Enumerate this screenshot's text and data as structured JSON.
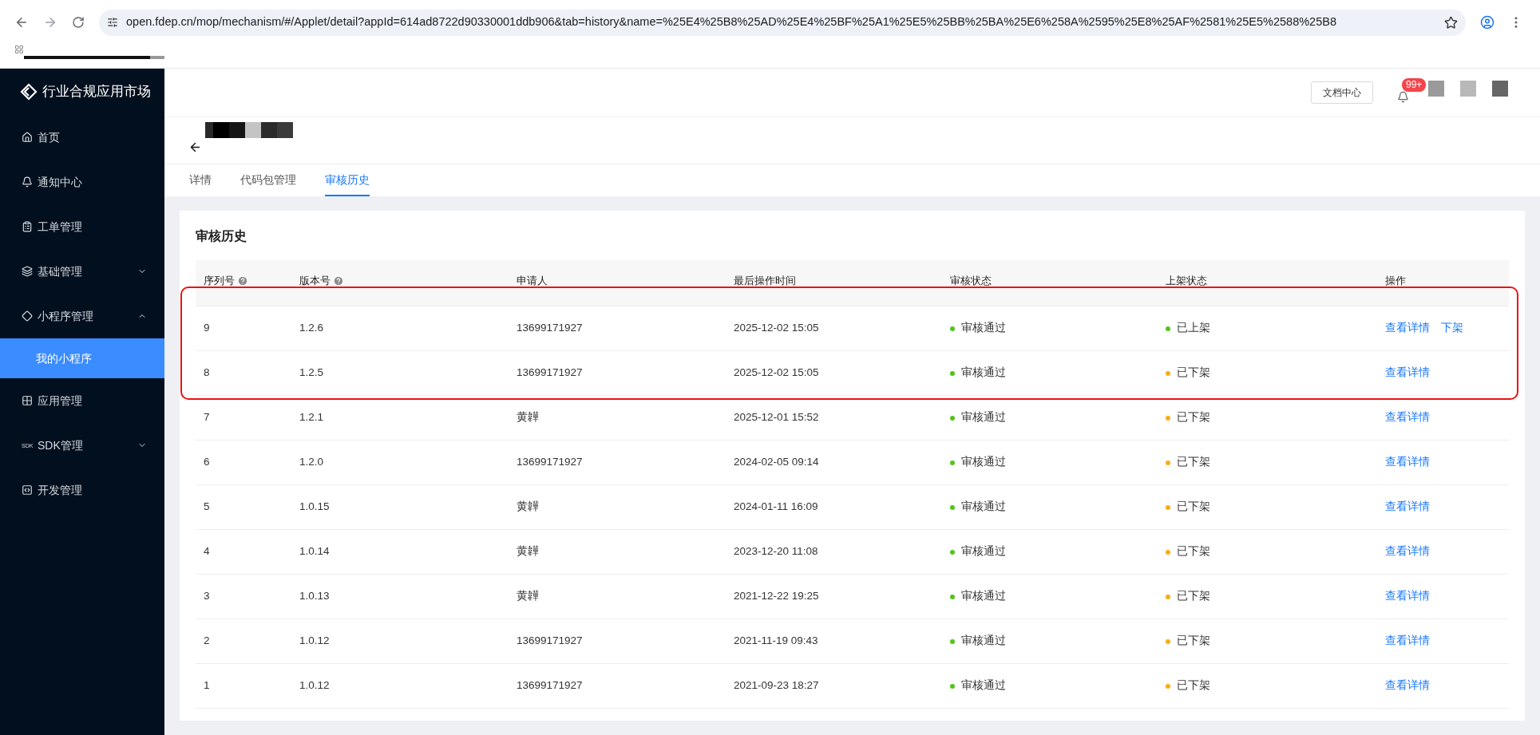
{
  "browser": {
    "url": "open.fdep.cn/mop/mechanism/#/Applet/detail?appId=614ad8722d90330001ddb906&tab=history&name=%25E4%25B8%25AD%25E4%25BF%25A1%25E5%25BB%25BA%25E6%258A%2595%25E8%25AF%2581%25E5%2588%25B8"
  },
  "sidebar": {
    "logo": "行业合规应用市场",
    "items": [
      {
        "label": "首页",
        "selected": false
      },
      {
        "label": "通知中心",
        "selected": false
      },
      {
        "label": "工单管理",
        "selected": false
      },
      {
        "label": "基础管理",
        "expanded": false,
        "selected": false
      },
      {
        "label": "小程序管理",
        "expanded": true,
        "selected": false,
        "children": [
          {
            "label": "我的小程序",
            "selected": true
          }
        ]
      },
      {
        "label": "应用管理",
        "selected": false
      },
      {
        "label": "SDK管理",
        "icon_text": "SDK",
        "expanded": false,
        "selected": false
      },
      {
        "label": "开发管理",
        "selected": false
      }
    ]
  },
  "header": {
    "docs_button": "文档中心",
    "notification_badge": "99+"
  },
  "tabs": [
    {
      "label": "详情",
      "selected": false
    },
    {
      "label": "代码包管理",
      "selected": false
    },
    {
      "label": "审核历史",
      "selected": true
    }
  ],
  "section_title": "审核历史",
  "table": {
    "columns": [
      {
        "label": "序列号",
        "help": true
      },
      {
        "label": "版本号",
        "help": true
      },
      {
        "label": "申请人",
        "help": false
      },
      {
        "label": "最后操作时间",
        "help": false
      },
      {
        "label": "审核状态",
        "help": false
      },
      {
        "label": "上架状态",
        "help": false
      },
      {
        "label": "操作",
        "help": false
      }
    ],
    "rows": [
      {
        "seq": "9",
        "version": "1.2.6",
        "applicant": "13699171927",
        "time": "2025-12-02 15:05",
        "review": {
          "text": "审核通过",
          "color": "#52c41a"
        },
        "listing": {
          "text": "已上架",
          "color": "#52c41a"
        },
        "actions": [
          "查看详情",
          "下架"
        ]
      },
      {
        "seq": "8",
        "version": "1.2.5",
        "applicant": "13699171927",
        "time": "2025-12-02 15:05",
        "review": {
          "text": "审核通过",
          "color": "#52c41a"
        },
        "listing": {
          "text": "已下架",
          "color": "#faad14"
        },
        "actions": [
          "查看详情"
        ]
      },
      {
        "seq": "7",
        "version": "1.2.1",
        "applicant": "黄韡",
        "time": "2025-12-01 15:52",
        "review": {
          "text": "审核通过",
          "color": "#52c41a"
        },
        "listing": {
          "text": "已下架",
          "color": "#faad14"
        },
        "actions": [
          "查看详情"
        ]
      },
      {
        "seq": "6",
        "version": "1.2.0",
        "applicant": "13699171927",
        "time": "2024-02-05 09:14",
        "review": {
          "text": "审核通过",
          "color": "#52c41a"
        },
        "listing": {
          "text": "已下架",
          "color": "#faad14"
        },
        "actions": [
          "查看详情"
        ]
      },
      {
        "seq": "5",
        "version": "1.0.15",
        "applicant": "黄韡",
        "time": "2024-01-11 16:09",
        "review": {
          "text": "审核通过",
          "color": "#52c41a"
        },
        "listing": {
          "text": "已下架",
          "color": "#faad14"
        },
        "actions": [
          "查看详情"
        ]
      },
      {
        "seq": "4",
        "version": "1.0.14",
        "applicant": "黄韡",
        "time": "2023-12-20 11:08",
        "review": {
          "text": "审核通过",
          "color": "#52c41a"
        },
        "listing": {
          "text": "已下架",
          "color": "#faad14"
        },
        "actions": [
          "查看详情"
        ]
      },
      {
        "seq": "3",
        "version": "1.0.13",
        "applicant": "黄韡",
        "time": "2021-12-22 19:25",
        "review": {
          "text": "审核通过",
          "color": "#52c41a"
        },
        "listing": {
          "text": "已下架",
          "color": "#faad14"
        },
        "actions": [
          "查看详情"
        ]
      },
      {
        "seq": "2",
        "version": "1.0.12",
        "applicant": "13699171927",
        "time": "2021-11-19 09:43",
        "review": {
          "text": "审核通过",
          "color": "#52c41a"
        },
        "listing": {
          "text": "已下架",
          "color": "#faad14"
        },
        "actions": [
          "查看详情"
        ]
      },
      {
        "seq": "1",
        "version": "1.0.12",
        "applicant": "13699171927",
        "time": "2021-09-23 18:27",
        "review": {
          "text": "审核通过",
          "color": "#52c41a"
        },
        "listing": {
          "text": "已下架",
          "color": "#faad14"
        },
        "actions": [
          "查看详情"
        ]
      }
    ]
  },
  "highlight": {
    "shown": true
  }
}
